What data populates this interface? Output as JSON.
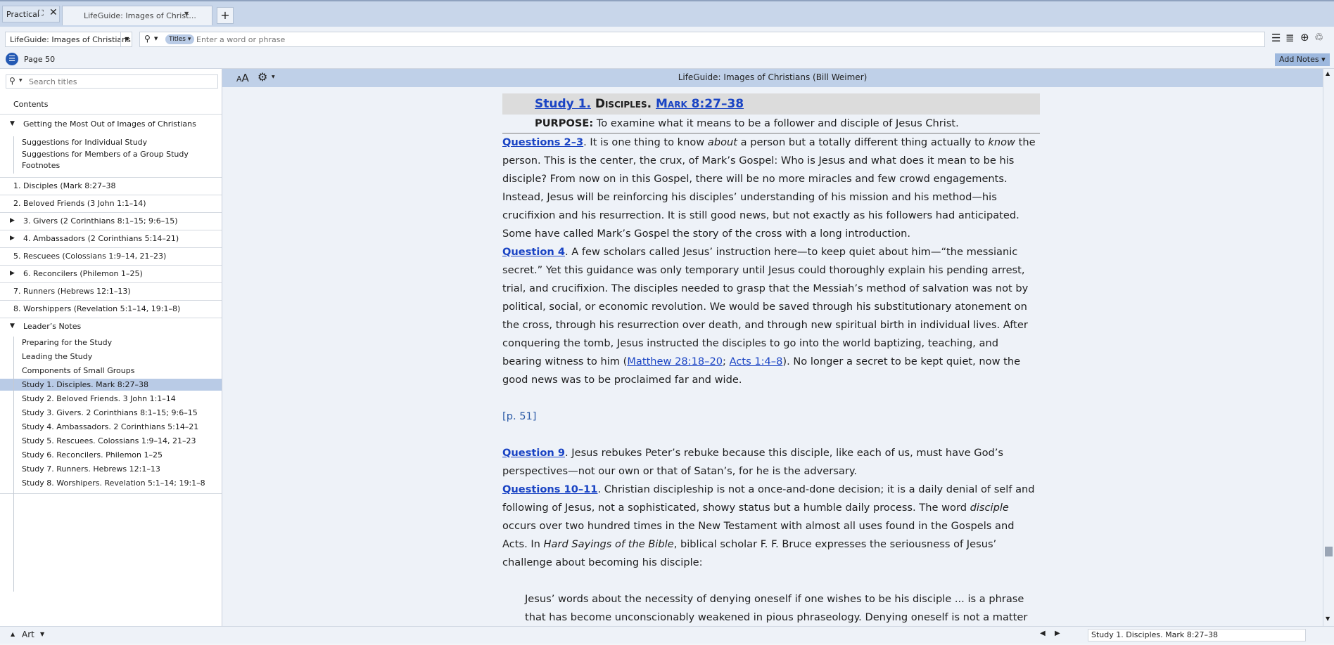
{
  "tabs": {
    "group_label": "Practical",
    "active_tab": "LifeGuide: Images of Christ...",
    "add_tab": "+"
  },
  "toolbar": {
    "resource": "LifeGuide: Images of Christians",
    "search_scope": "Titles",
    "search_placeholder": "Enter a word or phrase"
  },
  "pagebar": {
    "page": "Page 50",
    "add_notes": "Add Notes"
  },
  "sidebar": {
    "search_placeholder": "Search titles",
    "contents_label": "Contents",
    "items": [
      {
        "label": "Getting the Most Out of Images of Christians",
        "indent": 0,
        "tri": "down"
      },
      {
        "label": "Suggestions for Individual Study",
        "indent": 1
      },
      {
        "label": "Suggestions for Members of a Group Study",
        "indent": 1
      },
      {
        "label": "Footnotes",
        "indent": 1
      },
      {
        "label": "1. Disciples (Mark 8:27–38",
        "indent": 0
      },
      {
        "label": "2. Beloved Friends (3 John 1:1–14)",
        "indent": 0
      },
      {
        "label": "3. Givers (2 Corinthians 8:1–15; 9:6–15)",
        "indent": 0,
        "tri": "right"
      },
      {
        "label": "4. Ambassadors (2 Corinthians 5:14–21)",
        "indent": 0,
        "tri": "right"
      },
      {
        "label": "5. Rescuees (Colossians 1:9–14, 21–23)",
        "indent": 0
      },
      {
        "label": "6. Reconcilers (Philemon 1–25)",
        "indent": 0,
        "tri": "right"
      },
      {
        "label": "7. Runners (Hebrews 12:1–13)",
        "indent": 0
      },
      {
        "label": "8. Worshippers (Revelation 5:1–14, 19:1–8)",
        "indent": 0
      },
      {
        "label": "Leader’s Notes",
        "indent": 0,
        "tri": "down"
      },
      {
        "label": "Preparing for the Study",
        "indent": 1
      },
      {
        "label": "Leading the Study",
        "indent": 1
      },
      {
        "label": "Components of Small Groups",
        "indent": 1
      },
      {
        "label": "Study 1. Disciples. Mark 8:27–38",
        "indent": 1,
        "selected": true
      },
      {
        "label": "Study 2. Beloved Friends. 3 John 1:1–14",
        "indent": 1
      },
      {
        "label": "Study 3. Givers. 2 Corinthians 8:1–15; 9:6–15",
        "indent": 1
      },
      {
        "label": "Study 4. Ambassadors. 2 Corinthians 5:14–21",
        "indent": 1
      },
      {
        "label": "Study 5. Rescuees. Colossians 1:9–14, 21–23",
        "indent": 1
      },
      {
        "label": "Study 6. Reconcilers. Philemon 1–25",
        "indent": 1
      },
      {
        "label": "Study 7. Runners. Hebrews 12:1–13",
        "indent": 1
      },
      {
        "label": "Study 8. Worshipers. Revelation 5:1–14; 19:1–8",
        "indent": 1
      }
    ]
  },
  "content": {
    "font_size_icon": "AA",
    "title": "LifeGuide: Images of Christians (Bill Weimer)",
    "heading_study": "Study 1.",
    "heading_word": "Disciples.",
    "heading_ref": "Mark 8:27–38",
    "purpose_label": "PURPOSE:",
    "purpose_text": " To examine what it means to be a follower and disciple of Jesus Christ.",
    "q23_label": "Questions 2–3",
    "q23_a": ". It is one thing to know ",
    "q23_about": "about",
    "q23_b": " a person but a totally different thing actually to ",
    "q23_know": "know",
    "q23_c": " the person. This is the center, the crux, of Mark’s Gospel: Who is Jesus and what does it mean to be his disciple? From now on in this Gospel, there will be no more miracles and few crowd engagements. Instead, Jesus will be reinforcing his disciples’ understanding of his mission and his method—his crucifixion and his resurrection. It is still good news, but not exactly as his followers had anticipated. Some have called Mark’s Gospel the story of the cross with a long introduction.",
    "q4_label": "Question 4",
    "q4_a": ". A few scholars called Jesus’ instruction here—to keep quiet about him—“the messianic secret.” Yet this guidance was only temporary until Jesus could thoroughly explain his pending arrest, trial, and crucifixion. The disciples needed to grasp that the Messiah’s method of salvation was not by political, social, or economic revolution. We would be saved through his substitutionary atonement on the cross, through his resurrection over death, and through new spiritual birth in individual lives. After conquering the tomb, Jesus instructed the disciples to go into the world baptizing, teaching, and bearing witness to him (",
    "q4_ref1": "Matthew 28:18–20",
    "q4_sep": "; ",
    "q4_ref2": "Acts 1:4–8",
    "q4_b": "). No longer a secret to be kept quiet, now the good news was to be proclaimed far and wide.",
    "page_marker": "[p. 51]",
    "q9_label": "Question 9",
    "q9_text": ". Jesus rebukes Peter’s rebuke because this disciple, like each of us, must have God’s perspectives—not our own or that of Satan’s, for he is the adversary.",
    "q1011_label": "Questions 10–11",
    "q1011_a": ". Christian discipleship is not a once-and-done decision; it is a daily denial of self and following of Jesus, not a sophisticated, showy status but a humble daily process. The word ",
    "q1011_disciple": "disciple",
    "q1011_b": " occurs over two hundred times in the New Testament with almost all uses found in the Gospels and Acts. In ",
    "q1011_book": "Hard Sayings of the Bible",
    "q1011_c": ", biblical scholar F. F. Bruce expresses the seriousness of Jesus’ challenge about becoming his disciple:",
    "quote": "Jesus’ words about the necessity of denying oneself if one wishes to be his disciple ... is a phrase that has become unconscionably weakened in pious phraseology. Denying oneself is not a matter of giving"
  },
  "status": {
    "art_label": "Art",
    "reference": "Study 1. Disciples. Mark 8:27–38"
  },
  "colors": {
    "accent": "#1a44c4",
    "selected": "#b9cbe6",
    "titlebar": "#bfd0e8"
  }
}
